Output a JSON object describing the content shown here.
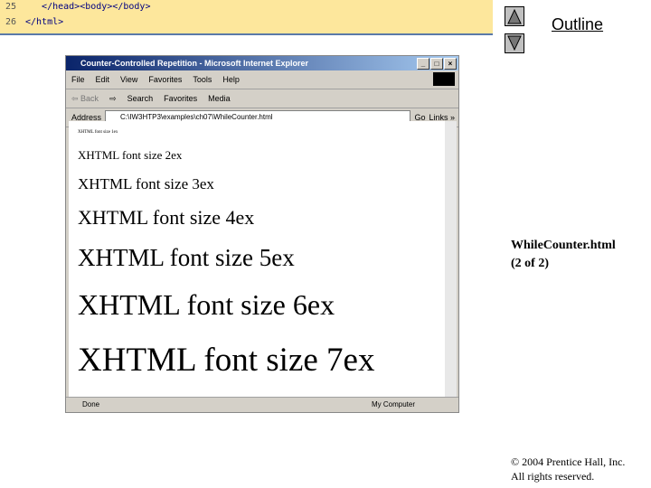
{
  "code": [
    {
      "line": "25",
      "text": "   </head><body></body>"
    },
    {
      "line": "26",
      "text": "</html>"
    }
  ],
  "nav": {
    "up": "▲",
    "down": "▼",
    "outline": "Outline"
  },
  "browser": {
    "title": "Counter-Controlled Repetition - Microsoft Internet Explorer",
    "menu": [
      "File",
      "Edit",
      "View",
      "Favorites",
      "Tools",
      "Help"
    ],
    "toolbar": [
      "⇦ Back",
      "⇨",
      "Search",
      "Favorites",
      "Media"
    ],
    "address_label": "Address",
    "address": "C:\\IW3HTP3\\examples\\ch07\\WhileCounter.html",
    "go": "Go",
    "links": "Links »",
    "lines": [
      "XHTML font size 1ex",
      "XHTML font size 2ex",
      "XHTML font size 3ex",
      "XHTML font size 4ex",
      "XHTML font size 5ex",
      "XHTML font size 6ex",
      "XHTML font size 7ex"
    ],
    "status": "Done",
    "zone": "My Computer"
  },
  "side": {
    "file": "WhileCounter.html",
    "page": "(2 of 2)"
  },
  "copyright": [
    "© 2004 Prentice Hall, Inc.",
    "All rights reserved."
  ]
}
